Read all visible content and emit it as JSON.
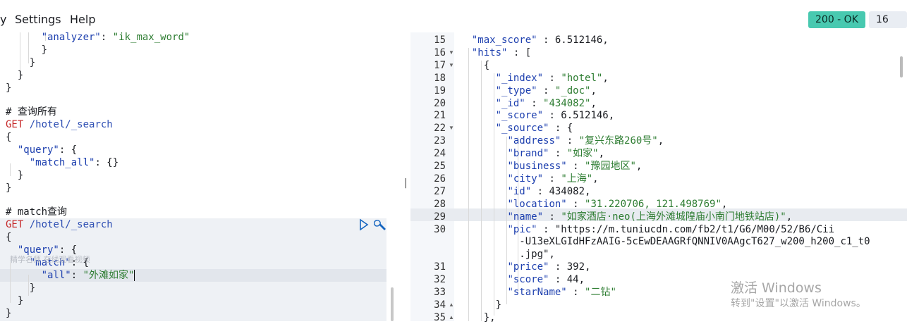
{
  "menu": {
    "item_partial": "y",
    "settings": "Settings",
    "help": "Help"
  },
  "status": {
    "code": "200 - OK",
    "time": "16 ms",
    "ok_color": "#48c9b0"
  },
  "left": {
    "lines": [
      {
        "t": "      \"analyzer\": \"ik_max_word\""
      },
      {
        "t": "    }"
      },
      {
        "t": "  }"
      },
      {
        "t": "}"
      },
      {
        "t": "}"
      },
      {
        "t": ""
      },
      {
        "t": "# 查询所有"
      },
      {
        "t": "GET /hotel/_search"
      },
      {
        "t": "{"
      },
      {
        "t": "  \"query\": {"
      },
      {
        "t": "    \"match_all\": {}"
      },
      {
        "t": "  }"
      },
      {
        "t": "}"
      },
      {
        "t": ""
      },
      {
        "t": ""
      },
      {
        "t": "# match查询"
      },
      {
        "t": "GET /hotel/_search"
      },
      {
        "t": "{"
      },
      {
        "t": "  \"query\": {"
      },
      {
        "t": "    \"match\": {"
      },
      {
        "t": "      \"all\": \"外滩如家\""
      },
      {
        "t": "    }"
      },
      {
        "t": "  }"
      },
      {
        "t": "}"
      }
    ],
    "watermark": "精学名师 在线观看视频"
  },
  "right": {
    "line_numbers": [
      "15",
      "16",
      "17",
      "18",
      "19",
      "20",
      "21",
      "22",
      "23",
      "24",
      "25",
      "26",
      "27",
      "28",
      "29",
      "30",
      "",
      "",
      "31",
      "32",
      "33",
      "34",
      "35"
    ],
    "lines": [
      "  \"max_score\" : 6.512146,",
      "  \"hits\" : [",
      "    {",
      "      \"_index\" : \"hotel\",",
      "      \"_type\" : \"_doc\",",
      "      \"_id\" : \"434082\",",
      "      \"_score\" : 6.512146,",
      "      \"_source\" : {",
      "        \"address\" : \"复兴东路260号\",",
      "        \"brand\" : \"如家\",",
      "        \"business\" : \"豫园地区\",",
      "        \"city\" : \"上海\",",
      "        \"id\" : 434082,",
      "        \"location\" : \"31.220706, 121.498769\",",
      "        \"name\" : \"如家酒店·neo(上海外滩城隍庙小南门地铁站店)\",",
      "        \"pic\" : \"https://m.tuniucdn.com/fb2/t1/G6/M00/52/B6/Cii",
      "          -U13eXLGIdHFzAAIG-5cEwDEAAGRfQNNIV0AAgcT627_w200_h200_c1_t0",
      "          .jpg\",",
      "        \"price\" : 392,",
      "        \"score\" : 44,",
      "        \"starName\" : \"二钻\"",
      "      }",
      "    },"
    ]
  },
  "windows": {
    "title": "激活 Windows",
    "subtitle": "转到\"设置\"以激活 Windows。"
  }
}
